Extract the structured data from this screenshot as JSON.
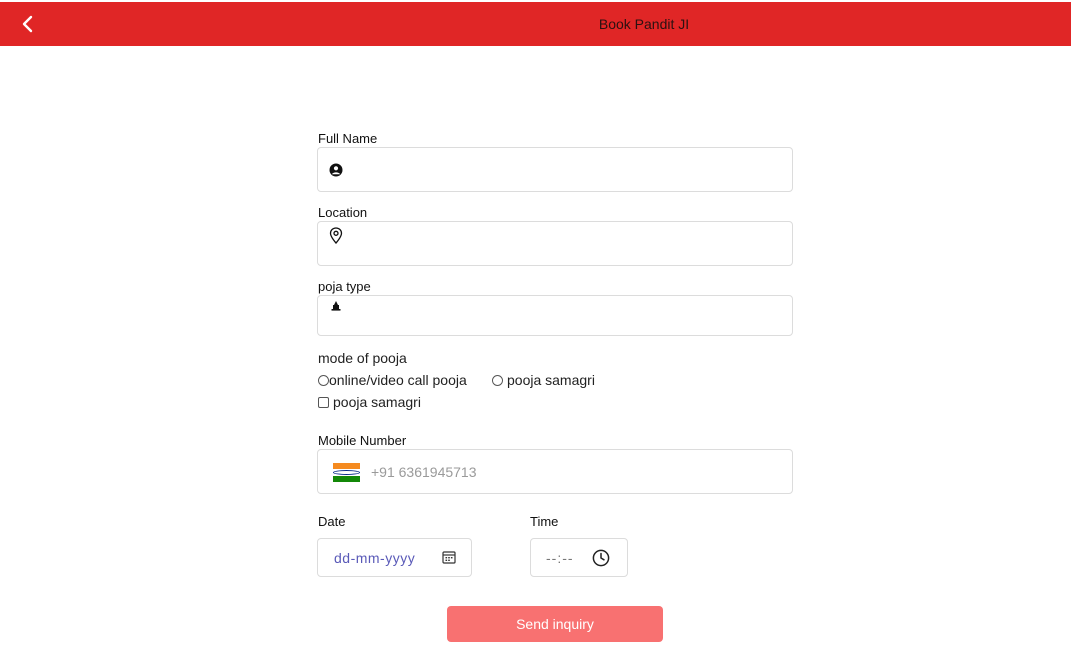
{
  "header": {
    "title": "Book Pandit JI",
    "background": "#e02626"
  },
  "form": {
    "full_name": {
      "label": "Full Name",
      "value": ""
    },
    "location": {
      "label": "Location",
      "value": ""
    },
    "pooja_type": {
      "label": "poja type",
      "value": ""
    },
    "mode": {
      "title": "mode of pooja",
      "options": [
        {
          "type": "radio",
          "label": "online/video call pooja",
          "checked": false
        },
        {
          "type": "radio",
          "label": "pooja samagri",
          "checked": false
        },
        {
          "type": "checkbox",
          "label": "pooja samagri",
          "checked": false
        }
      ]
    },
    "mobile": {
      "label": "Mobile Number",
      "placeholder": "+91 6361945713",
      "country": "India"
    },
    "date": {
      "label": "Date",
      "placeholder": "dd-mm-yyyy"
    },
    "time": {
      "label": "Time",
      "placeholder": "--:--"
    },
    "submit": {
      "label": "Send inquiry",
      "color": "#f87171"
    }
  },
  "icons": {
    "back": "chevron-left-icon",
    "name": "user-circle-icon",
    "location": "map-pin-icon",
    "pooja": "temple-icon",
    "date": "calendar-icon",
    "time": "clock-icon",
    "flag": "india-flag-icon"
  }
}
